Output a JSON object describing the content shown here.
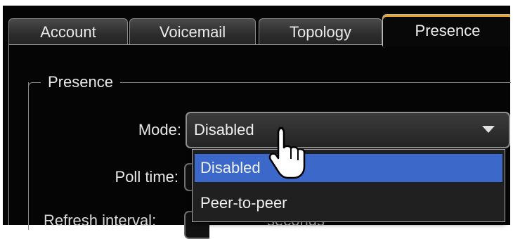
{
  "tabs": [
    {
      "label": "Account",
      "active": false
    },
    {
      "label": "Voicemail",
      "active": false
    },
    {
      "label": "Topology",
      "active": false
    },
    {
      "label": "Presence",
      "active": true
    }
  ],
  "group": {
    "title": "Presence",
    "mode_label": "Mode:",
    "mode_value": "Disabled",
    "poll_time_label": "Poll time:",
    "refresh_interval_label": "Refresh interval:",
    "refresh_unit": "seconds"
  },
  "dropdown": {
    "options": [
      {
        "label": "Disabled",
        "selected": true
      },
      {
        "label": "Peer-to-peer",
        "selected": false
      }
    ]
  },
  "colors": {
    "accent_tab": "#e8a22c",
    "selection": "#3b68c9",
    "background": "#050505"
  },
  "icons": {
    "cursor": "hand-pointer-icon",
    "combo_arrow": "chevron-down-icon"
  }
}
